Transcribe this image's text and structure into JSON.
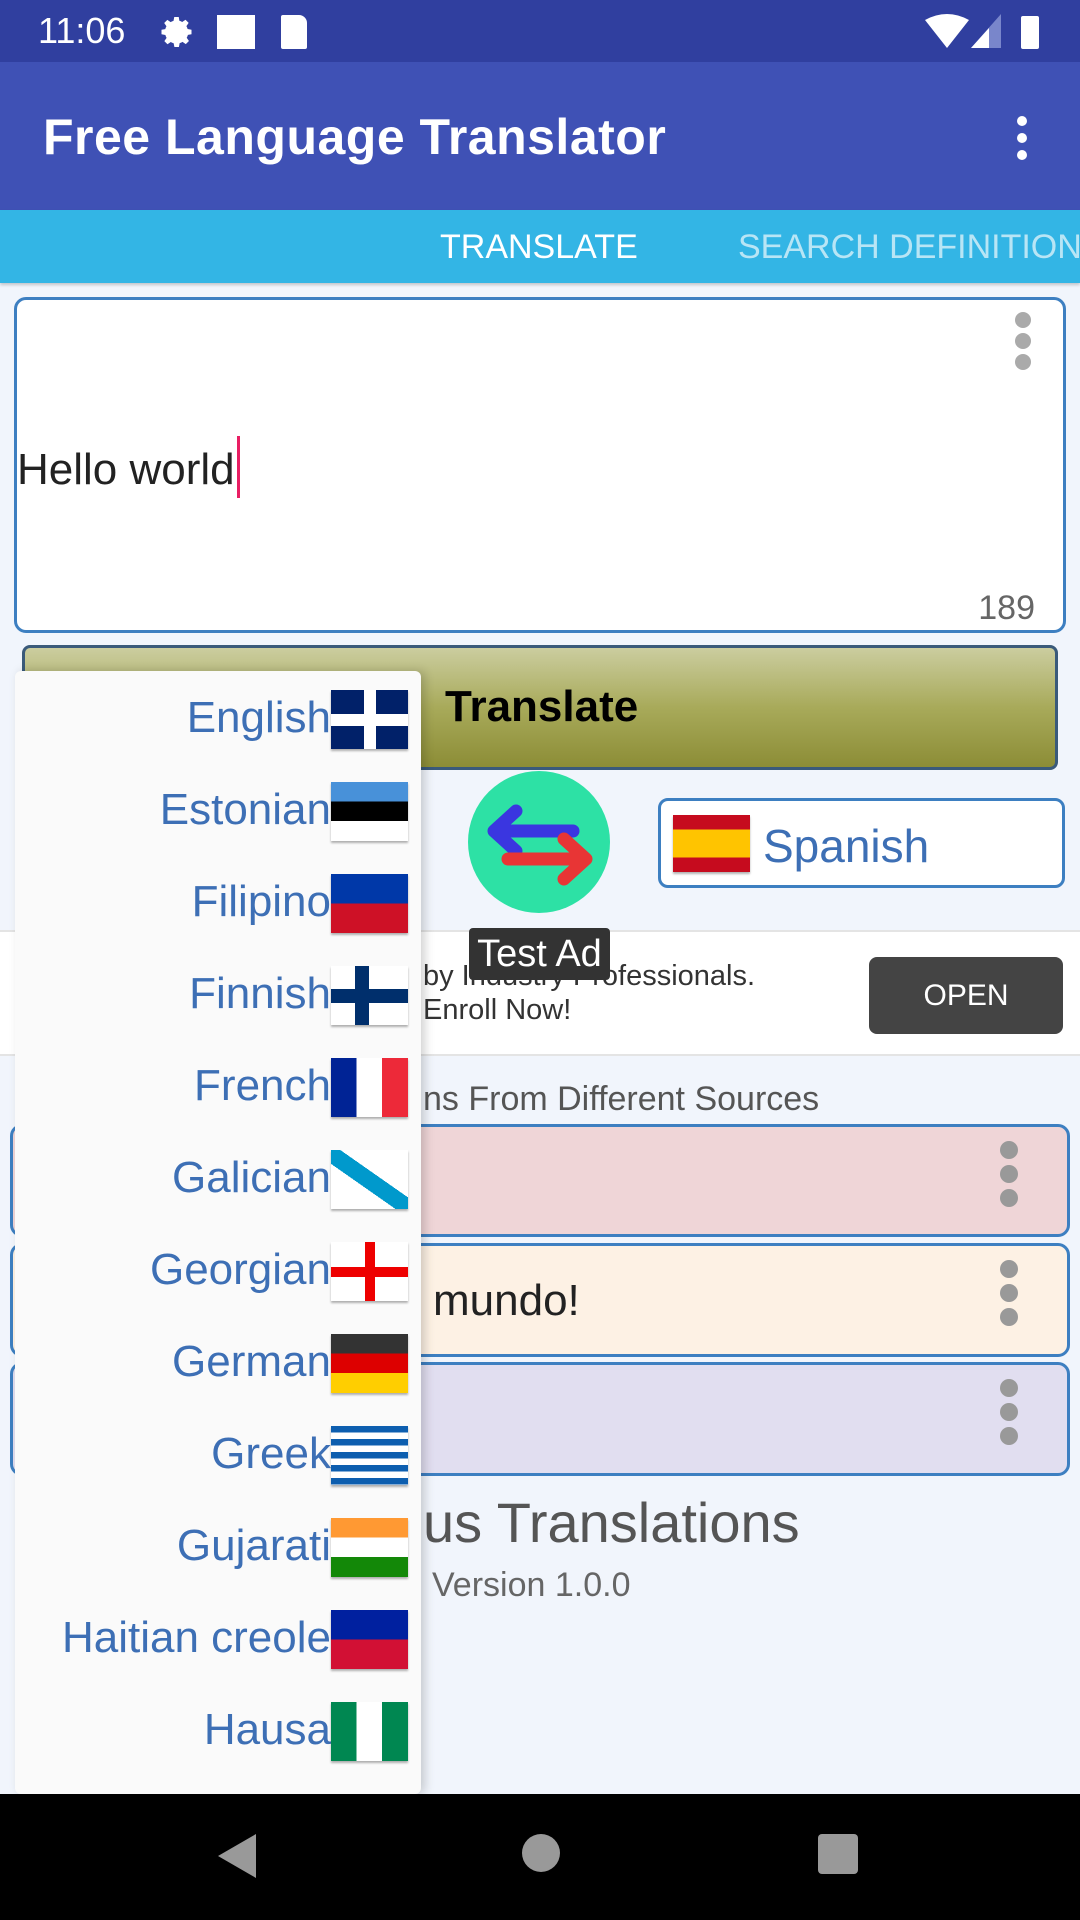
{
  "status_bar": {
    "time": "11:06",
    "icons": [
      "gear-icon",
      "square-icon",
      "sd-card-icon",
      "wifi-icon",
      "signal-icon",
      "battery-icon"
    ]
  },
  "app_bar": {
    "title": "Free Language Translator",
    "menu_icon": "more-vert-icon"
  },
  "tabs": [
    {
      "label": "TRANSLATE",
      "active": true
    },
    {
      "label": "SEARCH DEFINITION",
      "active": false
    }
  ],
  "input": {
    "value": "Hello world",
    "char_counter": "189"
  },
  "translate_button": {
    "label": "Translate"
  },
  "target_language": {
    "label": "Spanish",
    "flag": "spain-flag-icon"
  },
  "ad": {
    "badge": "Test Ad",
    "line1": "by Industry Professionals.",
    "line2": "Enroll Now!",
    "open_label": "OPEN"
  },
  "sources_heading": "ns From Different Sources",
  "results": [
    {
      "text": "",
      "bg": "#efd5d7"
    },
    {
      "text": "mundo!",
      "bg": "#fdf1e4"
    },
    {
      "text": "",
      "bg": "#e1def0"
    }
  ],
  "previous_heading": "us Translations",
  "version": "Version 1.0.0",
  "language_dropdown": {
    "items": [
      {
        "label": "English",
        "flag": "uk-flag-icon"
      },
      {
        "label": "Estonian",
        "flag": "estonia-flag-icon"
      },
      {
        "label": "Filipino",
        "flag": "philippines-flag-icon"
      },
      {
        "label": "Finnish",
        "flag": "finland-flag-icon"
      },
      {
        "label": "French",
        "flag": "france-flag-icon"
      },
      {
        "label": "Galician",
        "flag": "galicia-flag-icon"
      },
      {
        "label": "Georgian",
        "flag": "georgia-flag-icon"
      },
      {
        "label": "German",
        "flag": "germany-flag-icon"
      },
      {
        "label": "Greek",
        "flag": "greece-flag-icon"
      },
      {
        "label": "Gujarati",
        "flag": "india-flag-icon"
      },
      {
        "label": "Haitian creole",
        "flag": "haiti-flag-icon"
      },
      {
        "label": "Hausa",
        "flag": "nigeria-flag-icon"
      }
    ]
  },
  "colors": {
    "status_bar": "#303f9f",
    "app_bar": "#3f51b5",
    "tab_bar": "#33b5e5",
    "accent_border": "#3d7fc1",
    "link_text": "#3d6fb5",
    "swap_circle": "#2de1a5"
  }
}
